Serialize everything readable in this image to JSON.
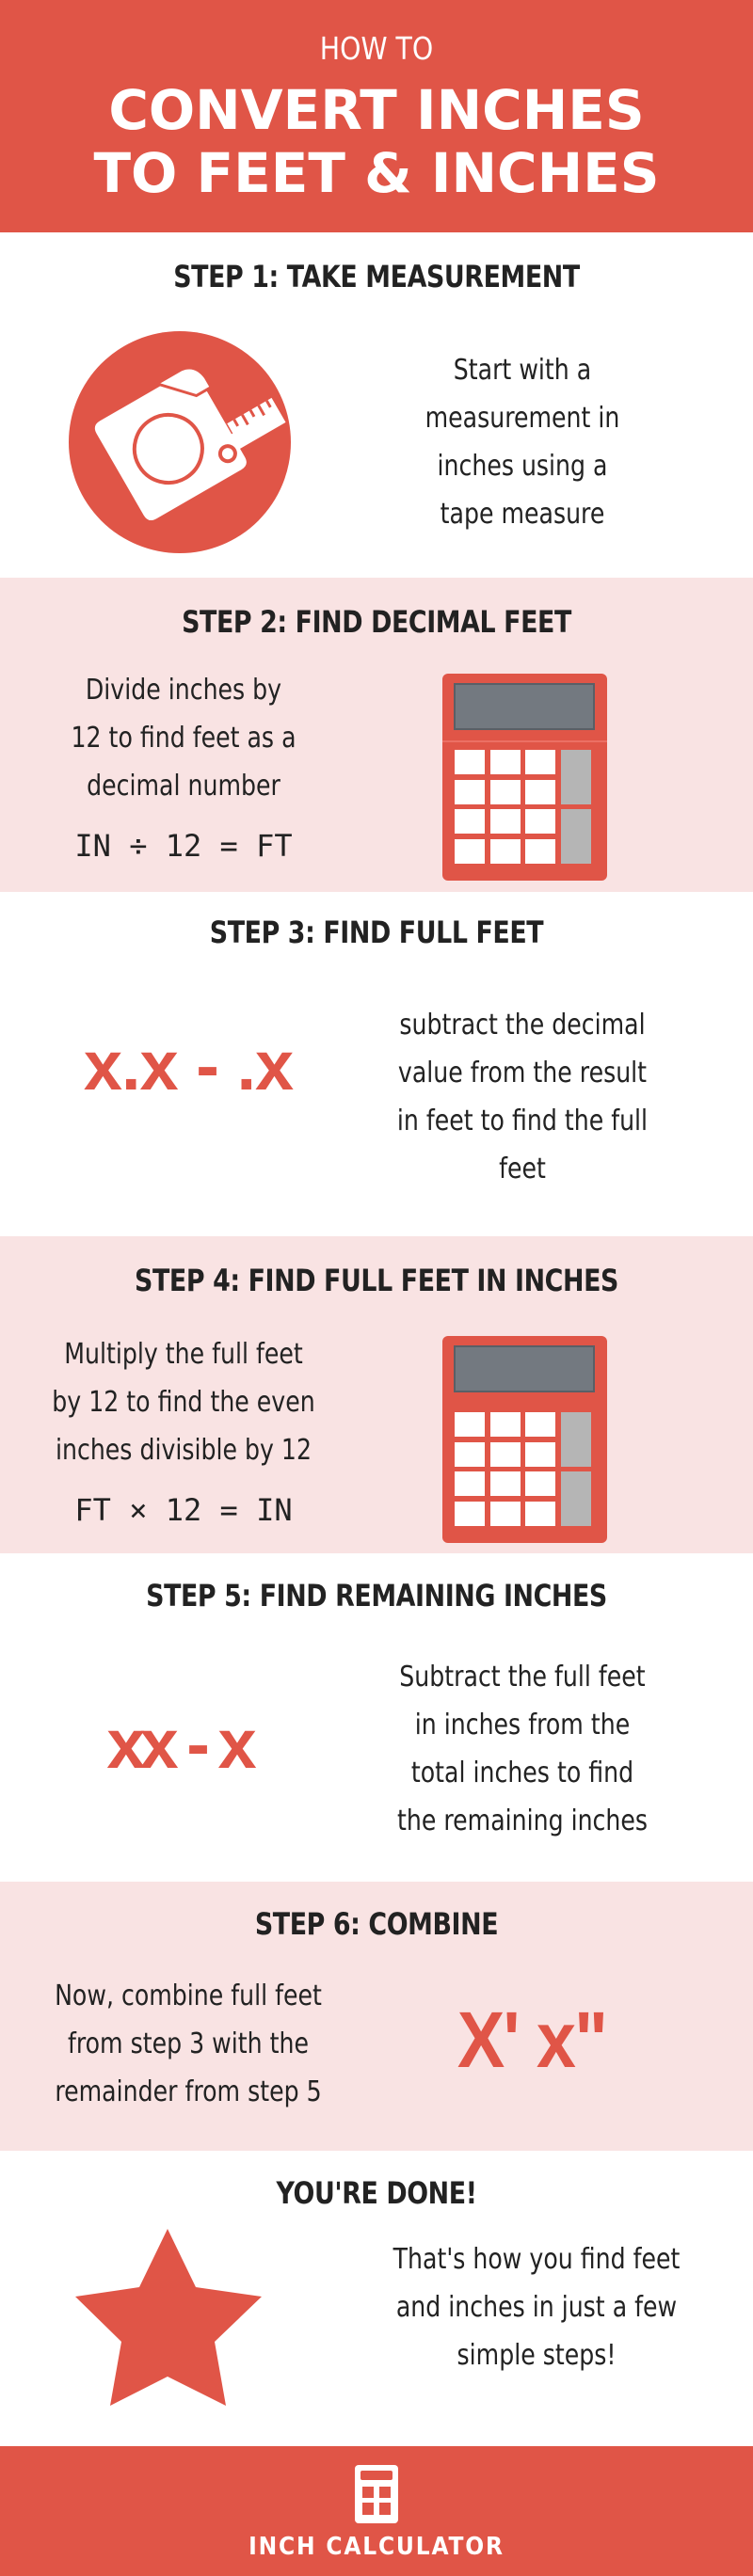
{
  "header": {
    "kicker": "HOW TO",
    "title_lines": [
      "CONVERT INCHES",
      "TO FEET & INCHES"
    ]
  },
  "colors": {
    "accent": "#e05547",
    "section_pink": "#f9e3e3",
    "text": "#222222",
    "calculator_screen": "#737980",
    "calculator_side_keys": "#b5b5b5"
  },
  "steps": [
    {
      "title": "STEP 1: TAKE MEASUREMENT",
      "icon": "tape-measure-icon",
      "text_lines": [
        "Start with a",
        "measurement in",
        "inches using a",
        "tape measure"
      ]
    },
    {
      "title": "STEP 2: FIND DECIMAL FEET",
      "icon": "calculator-icon",
      "text_lines": [
        "Divide inches by",
        "12 to find feet as a",
        "decimal number"
      ],
      "formula": "IN ÷ 12 = FT"
    },
    {
      "title": "STEP 3: FIND FULL FEET",
      "expression": "x.x - .x",
      "text_lines": [
        "subtract the decimal",
        "value from the result",
        "in feet to find the full",
        "feet"
      ]
    },
    {
      "title": "STEP 4: FIND FULL FEET IN INCHES",
      "icon": "calculator-icon",
      "text_lines": [
        "Multiply the full feet",
        "by 12 to find the even",
        "inches divisible by 12"
      ],
      "formula": "FT × 12 = IN"
    },
    {
      "title": "STEP 5: FIND REMAINING INCHES",
      "expression": "xx - x",
      "text_lines": [
        "Subtract the full feet",
        "in inches from the",
        "total inches to find",
        "the remaining inches"
      ]
    },
    {
      "title": "STEP 6: COMBINE",
      "expression": "X' x\"",
      "text_lines": [
        "Now, combine full feet",
        "from step 3 with the",
        "remainder from step 5"
      ]
    }
  ],
  "done": {
    "title": "YOU'RE DONE!",
    "icon": "star-icon",
    "text_lines": [
      "That's how you find feet",
      "and inches in just a few",
      "simple steps!"
    ]
  },
  "footer": {
    "icon": "calculator-logo-icon",
    "brand": "INCH CALCULATOR"
  }
}
